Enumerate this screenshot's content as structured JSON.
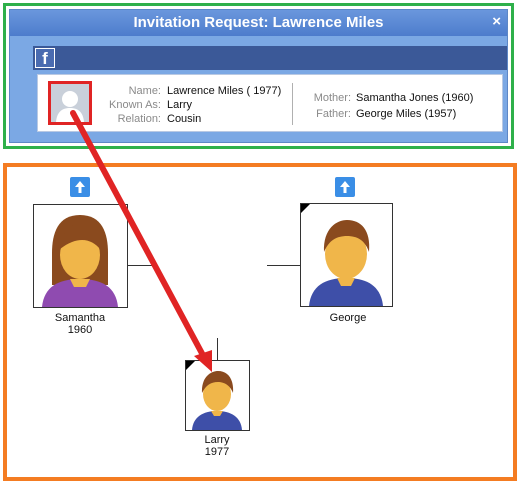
{
  "dialog": {
    "title": "Invitation Request: Lawrence Miles",
    "close_glyph": "×",
    "facebook_glyph": "f",
    "info": {
      "name_label": "Name:",
      "name_value": "Lawrence Miles ( 1977)",
      "known_as_label": "Known As:",
      "known_as_value": "Larry",
      "relation_label": "Relation:",
      "relation_value": "Cousin",
      "mother_label": "Mother:",
      "mother_value": "Samantha Jones (1960)",
      "father_label": "Father:",
      "father_value": "George Miles (1957)"
    }
  },
  "tree": {
    "mother": {
      "name": "Samantha",
      "year": "1960"
    },
    "father": {
      "name": "George"
    },
    "child": {
      "name": "Larry",
      "year": "1977"
    }
  },
  "colors": {
    "dialog_highlight": "#2eb04a",
    "tree_highlight": "#f47c22",
    "arrow": "#e02424",
    "facebook": "#3b5998",
    "window": "#7ba8e4"
  },
  "icons": {
    "close": "close-icon",
    "facebook": "facebook-icon",
    "up": "arrow-up-icon",
    "profile": "silhouette-icon"
  }
}
